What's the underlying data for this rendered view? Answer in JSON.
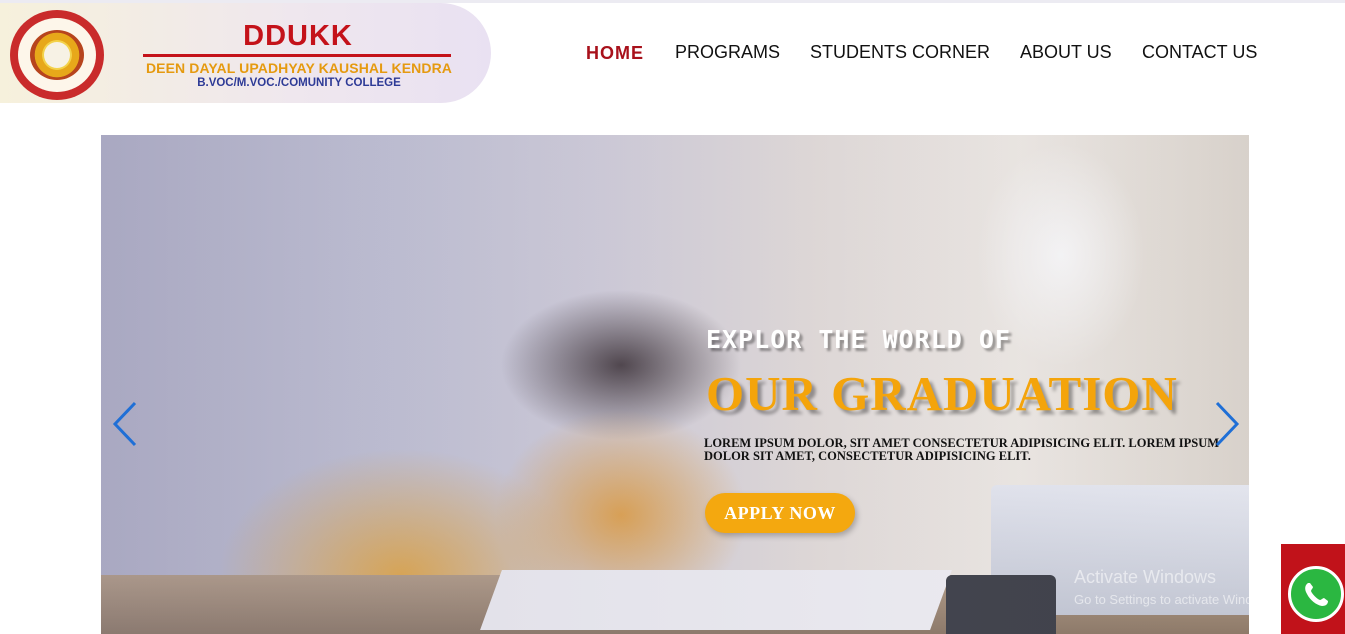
{
  "header": {
    "logo": {
      "title": "DDUKK",
      "subtitle": "DEEN DAYAL UPADHYAY KAUSHAL KENDRA",
      "tagline": "B.VOC/M.VOC./COMUNITY COLLEGE",
      "seal_icon": "college-seal-icon"
    },
    "nav": [
      {
        "label": "HOME",
        "active": true
      },
      {
        "label": "PROGRAMS",
        "active": false
      },
      {
        "label": "STUDENTS CORNER",
        "active": false
      },
      {
        "label": "ABOUT US",
        "active": false
      },
      {
        "label": "CONTACT US",
        "active": false
      }
    ]
  },
  "hero": {
    "line1": "EXPLOR THE WORLD OF",
    "line2": "OUR GRADUATION",
    "paragraph": "LOREM IPSUM DOLOR, SIT AMET CONSECTETUR ADIPISICING ELIT. LOREM IPSUM DOLOR SIT AMET, CONSECTETUR ADIPISICING ELIT.",
    "button": "APPLY NOW",
    "prev_icon": "chevron-left-icon",
    "next_icon": "chevron-right-icon"
  },
  "overlay": {
    "activate_title": "Activate Windows",
    "activate_sub": "Go to Settings to activate Windows."
  },
  "whatsapp": {
    "icon": "whatsapp-icon"
  },
  "colors": {
    "nav_active": "#a8111b",
    "brand_red": "#c4121a",
    "brand_orange": "#e59a10",
    "brand_blue": "#2d3a96",
    "accent": "#f4a80f",
    "arrow": "#1f6fd6",
    "whatsapp_green": "#2bb741"
  }
}
